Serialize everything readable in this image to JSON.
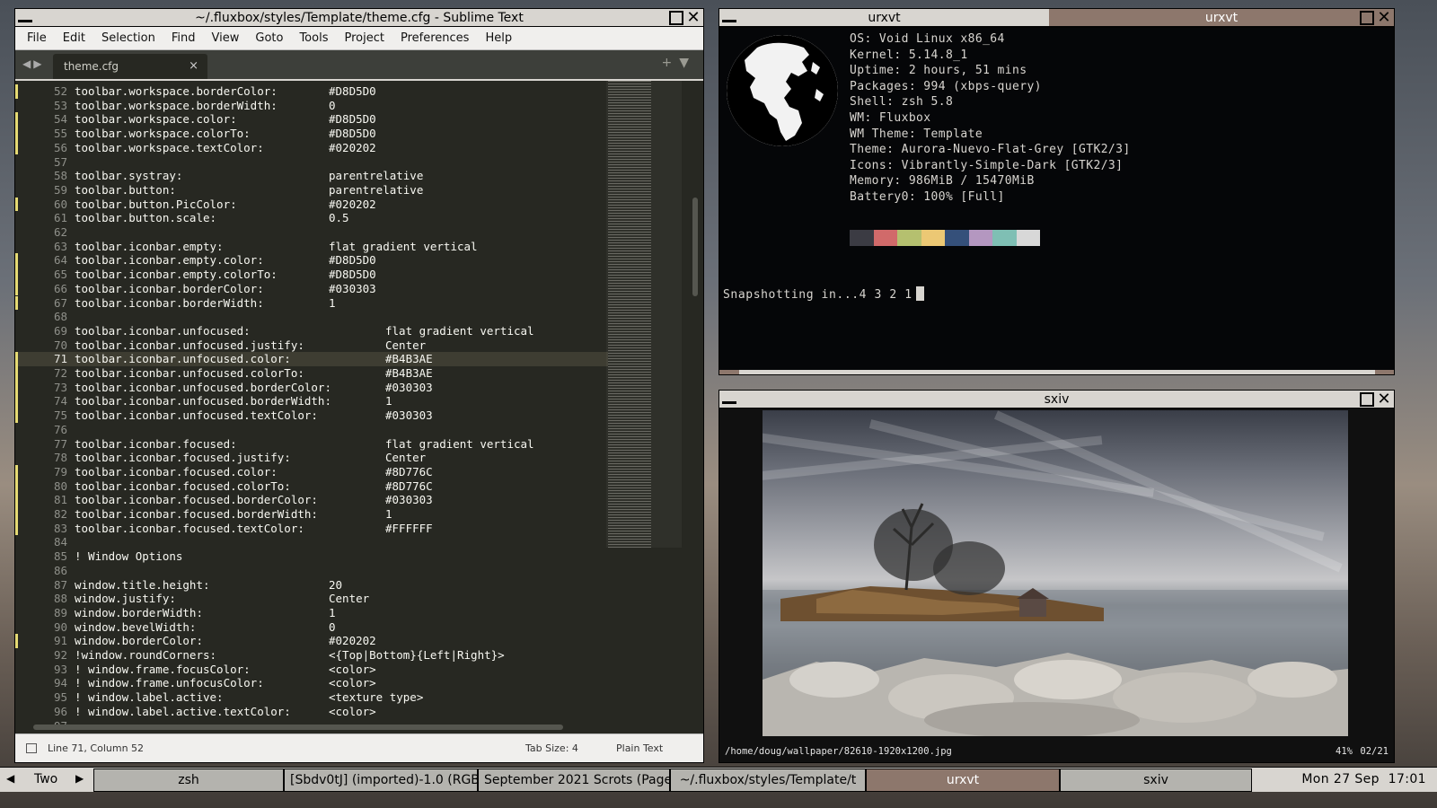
{
  "sublime": {
    "title": "~/.fluxbox/styles/Template/theme.cfg - Sublime Text",
    "menu": [
      "File",
      "Edit",
      "Selection",
      "Find",
      "View",
      "Goto",
      "Tools",
      "Project",
      "Preferences",
      "Help"
    ],
    "tab_label": "theme.cfg",
    "tab_close": "×",
    "lines": [
      {
        "n": "52",
        "k": "toolbar.workspace.borderColor:",
        "v": "#D8D5D0",
        "col": 0,
        "m": true
      },
      {
        "n": "53",
        "k": "toolbar.workspace.borderWidth:",
        "v": "0",
        "col": 0,
        "m": false
      },
      {
        "n": "54",
        "k": "toolbar.workspace.color:",
        "v": "#D8D5D0",
        "col": 0,
        "m": true
      },
      {
        "n": "55",
        "k": "toolbar.workspace.colorTo:",
        "v": "#D8D5D0",
        "col": 0,
        "m": true
      },
      {
        "n": "56",
        "k": "toolbar.workspace.textColor:",
        "v": "#020202",
        "col": 0,
        "m": true
      },
      {
        "n": "57",
        "k": "",
        "v": "",
        "col": 0,
        "m": false
      },
      {
        "n": "58",
        "k": "toolbar.systray:",
        "v": "parentrelative",
        "col": 0,
        "m": false
      },
      {
        "n": "59",
        "k": "toolbar.button:",
        "v": "parentrelative",
        "col": 0,
        "m": false
      },
      {
        "n": "60",
        "k": "toolbar.button.PicColor:",
        "v": "#020202",
        "col": 0,
        "m": true
      },
      {
        "n": "61",
        "k": "toolbar.button.scale:",
        "v": "0.5",
        "col": 0,
        "m": false
      },
      {
        "n": "62",
        "k": "",
        "v": "",
        "col": 0,
        "m": false
      },
      {
        "n": "63",
        "k": "toolbar.iconbar.empty:",
        "v": "flat gradient vertical",
        "col": 0,
        "m": false
      },
      {
        "n": "64",
        "k": "toolbar.iconbar.empty.color:",
        "v": "#D8D5D0",
        "col": 0,
        "m": true
      },
      {
        "n": "65",
        "k": "toolbar.iconbar.empty.colorTo:",
        "v": "#D8D5D0",
        "col": 0,
        "m": true
      },
      {
        "n": "66",
        "k": "toolbar.iconbar.borderColor:",
        "v": "#030303",
        "col": 0,
        "m": true
      },
      {
        "n": "67",
        "k": "toolbar.iconbar.borderWidth:",
        "v": "1",
        "col": 0,
        "m": true
      },
      {
        "n": "68",
        "k": "",
        "v": "",
        "col": 0,
        "m": false
      },
      {
        "n": "69",
        "k": "toolbar.iconbar.unfocused:",
        "v": "flat gradient vertical",
        "col": 1,
        "m": false
      },
      {
        "n": "70",
        "k": "toolbar.iconbar.unfocused.justify:",
        "v": "Center",
        "col": 1,
        "m": false
      },
      {
        "n": "71",
        "k": "toolbar.iconbar.unfocused.color:",
        "v": "#B4B3AE",
        "col": 1,
        "m": true,
        "cur": true
      },
      {
        "n": "72",
        "k": "toolbar.iconbar.unfocused.colorTo:",
        "v": "#B4B3AE",
        "col": 1,
        "m": true
      },
      {
        "n": "73",
        "k": "toolbar.iconbar.unfocused.borderColor:",
        "v": "#030303",
        "col": 1,
        "m": true
      },
      {
        "n": "74",
        "k": "toolbar.iconbar.unfocused.borderWidth:",
        "v": "1",
        "col": 1,
        "m": true
      },
      {
        "n": "75",
        "k": "toolbar.iconbar.unfocused.textColor:",
        "v": "#030303",
        "col": 1,
        "m": true
      },
      {
        "n": "76",
        "k": "",
        "v": "",
        "col": 0,
        "m": false
      },
      {
        "n": "77",
        "k": "toolbar.iconbar.focused:",
        "v": "flat gradient vertical",
        "col": 1,
        "m": false
      },
      {
        "n": "78",
        "k": "toolbar.iconbar.focused.justify:",
        "v": "Center",
        "col": 1,
        "m": false
      },
      {
        "n": "79",
        "k": "toolbar.iconbar.focused.color:",
        "v": "#8D776C",
        "col": 1,
        "m": true
      },
      {
        "n": "80",
        "k": "toolbar.iconbar.focused.colorTo:",
        "v": "#8D776C",
        "col": 1,
        "m": true
      },
      {
        "n": "81",
        "k": "toolbar.iconbar.focused.borderColor:",
        "v": "#030303",
        "col": 1,
        "m": true
      },
      {
        "n": "82",
        "k": "toolbar.iconbar.focused.borderWidth:",
        "v": "1",
        "col": 1,
        "m": true
      },
      {
        "n": "83",
        "k": "toolbar.iconbar.focused.textColor:",
        "v": "#FFFFFF",
        "col": 1,
        "m": true
      },
      {
        "n": "84",
        "k": "",
        "v": "",
        "col": 0,
        "m": false
      },
      {
        "n": "85",
        "k": "! Window Options",
        "v": "",
        "col": 0,
        "m": false
      },
      {
        "n": "86",
        "k": "",
        "v": "",
        "col": 0,
        "m": false
      },
      {
        "n": "87",
        "k": "window.title.height:",
        "v": "20",
        "col": 0,
        "m": false
      },
      {
        "n": "88",
        "k": "window.justify:",
        "v": "Center",
        "col": 0,
        "m": false
      },
      {
        "n": "89",
        "k": "window.borderWidth:",
        "v": "1",
        "col": 0,
        "m": false
      },
      {
        "n": "90",
        "k": "window.bevelWidth:",
        "v": "0",
        "col": 0,
        "m": false
      },
      {
        "n": "91",
        "k": "window.borderColor:",
        "v": "#020202",
        "col": 0,
        "m": true
      },
      {
        "n": "92",
        "k": "!window.roundCorners:",
        "v": "<{Top|Bottom}{Left|Right}>",
        "col": 0,
        "m": false
      },
      {
        "n": "93",
        "k": "! window.frame.focusColor:",
        "v": "<color>",
        "col": 0,
        "m": false
      },
      {
        "n": "94",
        "k": "! window.frame.unfocusColor:",
        "v": "<color>",
        "col": 0,
        "m": false
      },
      {
        "n": "95",
        "k": "! window.label.active:",
        "v": "<texture type>",
        "col": 0,
        "m": false
      },
      {
        "n": "96",
        "k": "! window.label.active.textColor:",
        "v": "<color>",
        "col": 0,
        "m": false
      },
      {
        "n": "97",
        "k": "",
        "v": "",
        "col": 0,
        "m": false
      }
    ],
    "status_position": "Line 71, Column 52",
    "status_tab_size": "Tab Size: 4",
    "status_syntax": "Plain Text"
  },
  "urxvt": {
    "tab1_title": "urxvt",
    "tab2_title": "urxvt",
    "info": [
      "OS: Void Linux x86_64",
      "Kernel: 5.14.8_1",
      "Uptime: 2 hours, 51 mins",
      "Packages: 994 (xbps-query)",
      "Shell: zsh 5.8",
      "WM: Fluxbox",
      "WM Theme: Template",
      "Theme: Aurora-Nuevo-Flat-Grey [GTK2/3]",
      "Icons: Vibrantly-Simple-Dark [GTK2/3]",
      "Memory: 986MiB / 15470MiB",
      "Battery0: 100% [Full]"
    ],
    "palette": [
      "#3b3b43",
      "#d16a6a",
      "#b5c06f",
      "#ecc874",
      "#35507a",
      "#b497c0",
      "#7fbfb4",
      "#d8d8d8"
    ],
    "snapshot_line": "Snapshotting in...4 3 2 1"
  },
  "sxiv": {
    "title": "sxiv",
    "path": "/home/doug/wallpaper/82610-1920x1200.jpg",
    "zoom": "41%",
    "index": "02/21"
  },
  "taskbar": {
    "workspace": "Two",
    "tasks": [
      {
        "label": "zsh",
        "focused": false
      },
      {
        "label": "[Sbdv0tJ] (imported)-1.0 (RGB",
        "focused": false
      },
      {
        "label": "September 2021 Scrots (Page 2",
        "focused": false
      },
      {
        "label": "~/.fluxbox/styles/Template/t",
        "focused": false
      },
      {
        "label": "urxvt",
        "focused": true
      },
      {
        "label": "sxiv",
        "focused": false
      }
    ],
    "clock": "Mon 27 Sep  17:01"
  },
  "colors": {
    "title_bg": "#D8D5D0",
    "focused": "#8D776C",
    "unfocused": "#B4B3AE",
    "editor_bg": "#272822"
  }
}
